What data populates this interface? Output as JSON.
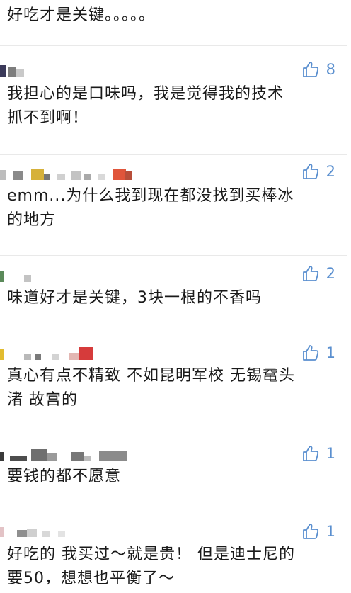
{
  "top_comment_text": "好吃才是关键。。。。。",
  "comments": [
    {
      "text_line1": "我担心的是口味吗，我是觉得我的技术",
      "text_line2": "抓不到啊！",
      "likes": "8"
    },
    {
      "text_line1": "emm...为什么我到现在都没找到买棒冰",
      "text_line2": "的地方",
      "likes": "2"
    },
    {
      "text_line1": "味道好才是关键，3块一根的不香吗",
      "likes": "2"
    },
    {
      "text_line1": "真心有点不精致 不如昆明军校 无锡鼋头",
      "text_line2": "渚 故宫的",
      "likes": "1"
    },
    {
      "text_line1": "要钱的都不愿意",
      "likes": "1"
    },
    {
      "text_line1": "好吃的 我买过～就是贵！ 但是迪士尼的",
      "text_line2": "要50，想想也平衡了～",
      "likes": "1"
    }
  ],
  "icons": {
    "like": "thumbs-up-icon"
  },
  "colors": {
    "like_blue": "#5a8fcf"
  }
}
